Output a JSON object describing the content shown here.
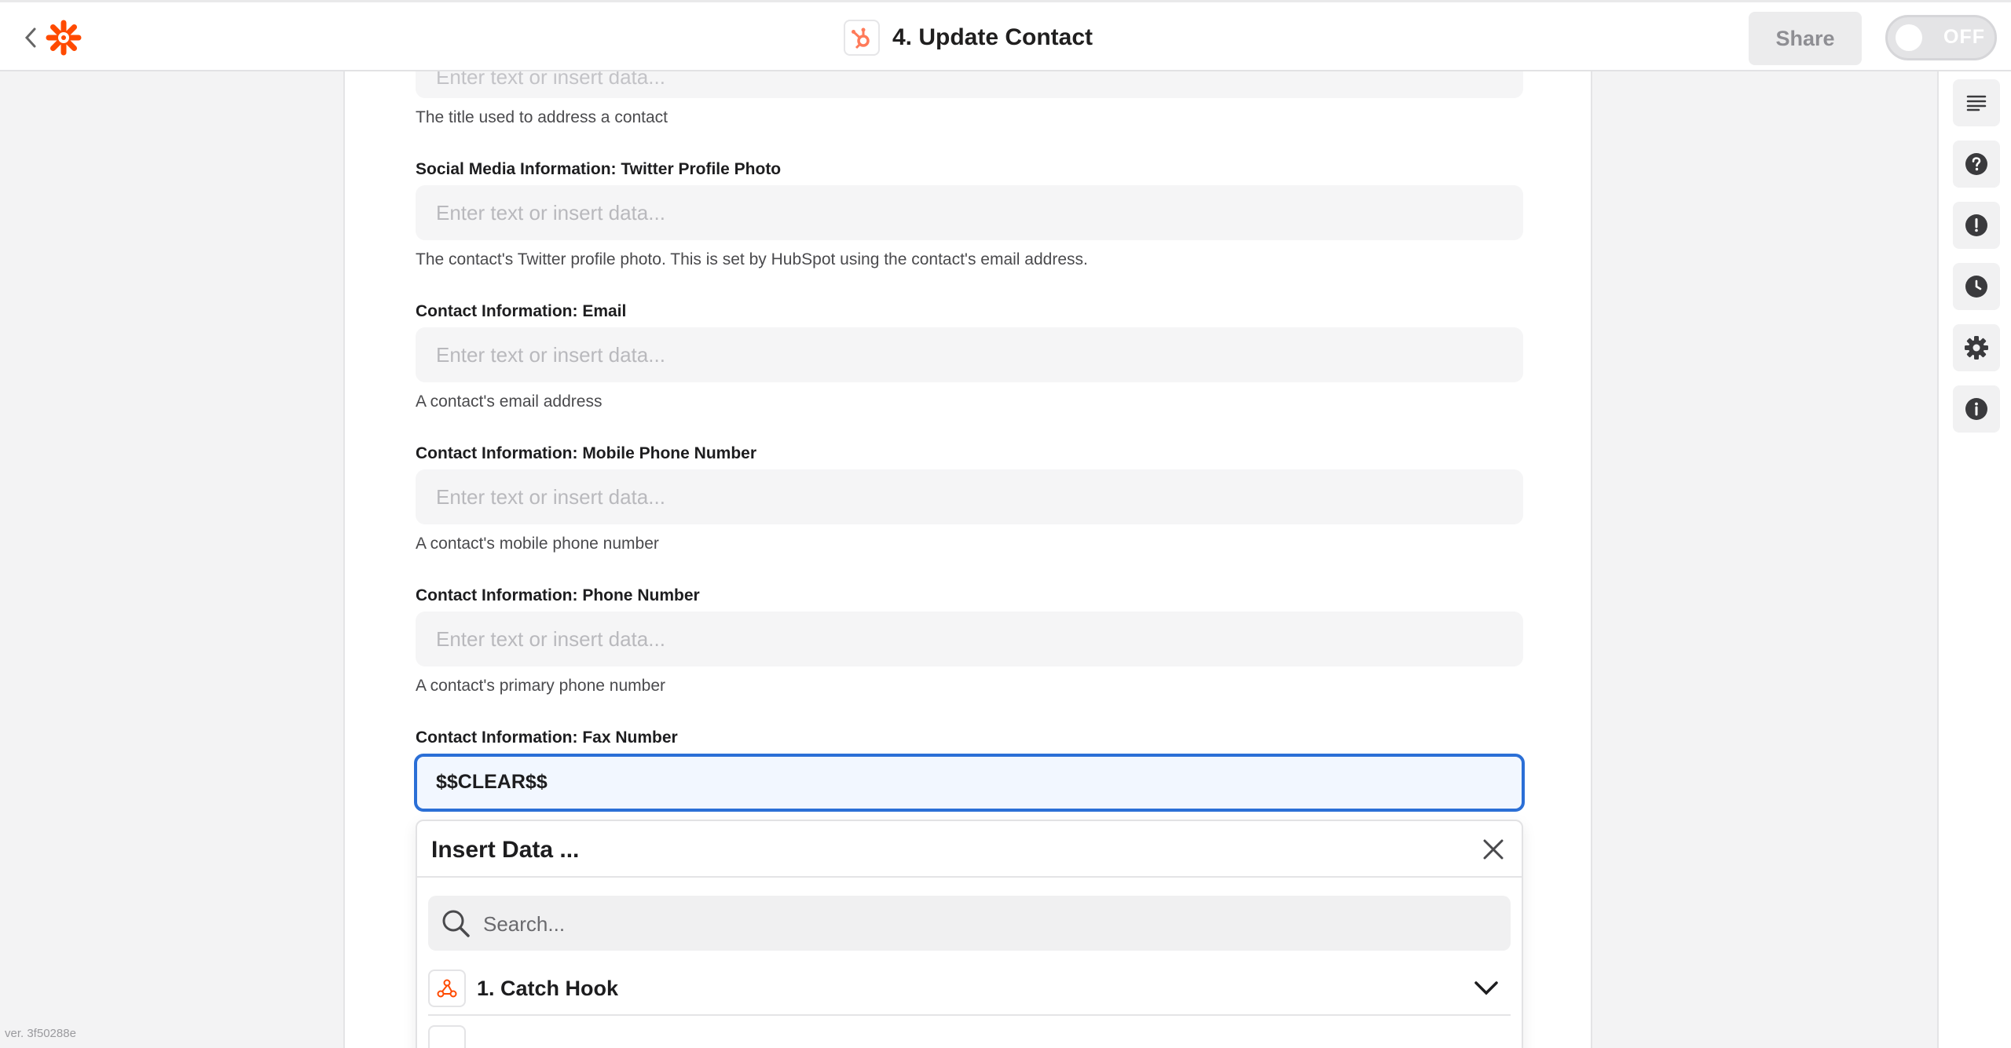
{
  "header": {
    "title": "4. Update Contact",
    "share_label": "Share",
    "toggle_label": "OFF",
    "brand_color": "#ff4a00",
    "hubspot_color": "#ff7a59"
  },
  "version": "ver. 3f50288e",
  "form": {
    "partial_placeholder": "Enter text or insert data...",
    "partial_help": "The title used to address a contact",
    "fields": [
      {
        "label": "Social Media Information: Twitter Profile Photo",
        "placeholder": "Enter text or insert data...",
        "help": "The contact's Twitter profile photo. This is set by HubSpot using the contact's email address."
      },
      {
        "label": "Contact Information: Email",
        "placeholder": "Enter text or insert data...",
        "help": "A contact's email address"
      },
      {
        "label": "Contact Information: Mobile Phone Number",
        "placeholder": "Enter text or insert data...",
        "help": "A contact's mobile phone number"
      },
      {
        "label": "Contact Information: Phone Number",
        "placeholder": "Enter text or insert data...",
        "help": "A contact's primary phone number"
      },
      {
        "label": "Contact Information: Fax Number",
        "value": "$$CLEAR$$"
      }
    ]
  },
  "insert_data": {
    "title": "Insert Data ...",
    "search_placeholder": "Search...",
    "steps": [
      {
        "label": "1. Catch Hook",
        "icon": "webhook-icon"
      }
    ]
  },
  "sidebar_icons": [
    "outline-icon",
    "help-icon",
    "alert-icon",
    "history-icon",
    "settings-icon",
    "info-icon"
  ]
}
